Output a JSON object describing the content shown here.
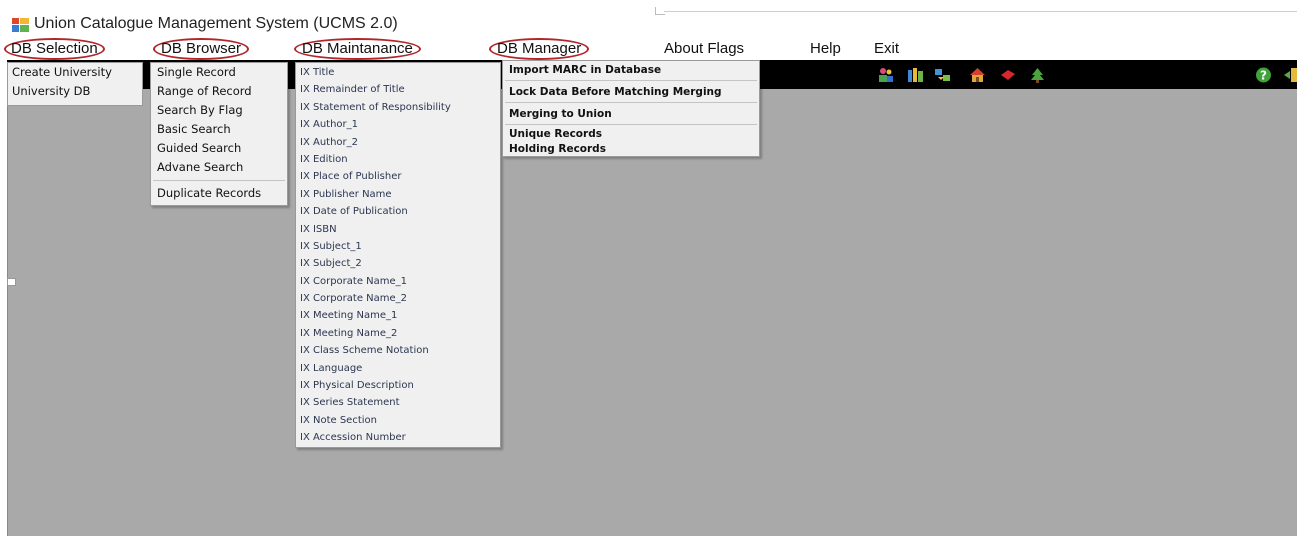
{
  "app": {
    "title": "Union Catalogue Management System (UCMS 2.0)"
  },
  "menu": [
    {
      "label": "DB Selection",
      "circled": true
    },
    {
      "label": "DB Browser",
      "circled": true
    },
    {
      "label": "DB Maintanance",
      "circled": true
    },
    {
      "label": "DB Manager",
      "circled": true
    },
    {
      "label": "About Flags",
      "circled": false
    },
    {
      "label": "Help",
      "circled": false
    },
    {
      "label": "Exit",
      "circled": false
    }
  ],
  "db_selection_menu": {
    "items": [
      "Create University",
      "University DB"
    ]
  },
  "db_browser_menu": {
    "items": [
      "Single Record",
      "Range of Record",
      "Search By Flag",
      "Basic Search",
      "Guided Search",
      "Advane Search"
    ],
    "after_separator": [
      "Duplicate Records"
    ]
  },
  "db_maintanance_menu": {
    "items": [
      "IX Title",
      "IX Remainder of Title",
      "IX Statement of Responsibility",
      "IX Author_1",
      "IX Author_2",
      "IX Edition",
      "IX Place of Publisher",
      "IX Publisher Name",
      "IX Date of Publication",
      "IX ISBN",
      "IX Subject_1",
      "IX Subject_2",
      "IX Corporate Name_1",
      "IX Corporate Name_2",
      "IX Meeting Name_1",
      "IX Meeting Name_2",
      "IX Class Scheme Notation",
      "IX Language",
      "IX Physical Description",
      "IX Series Statement",
      "IX Note Section",
      "IX Accession Number"
    ]
  },
  "db_manager_menu": {
    "group1": [
      "Import MARC in Database"
    ],
    "group2": [
      "Lock Data Before Matching Merging"
    ],
    "group3": [
      "Merging to Union"
    ],
    "group4": [
      "Unique Records",
      "Holding Records"
    ]
  },
  "toolbar_icons": [
    "users-icon",
    "books-icon",
    "transfer-icon",
    "house-icon",
    "red-book-icon",
    "tree-icon",
    "help-icon",
    "exit-door-icon"
  ],
  "colors": {
    "circle_highlight": "#b0262b",
    "client_background": "#a9a9a9",
    "toolbar_background": "#000000",
    "menu_background": "#f0f0f0"
  }
}
